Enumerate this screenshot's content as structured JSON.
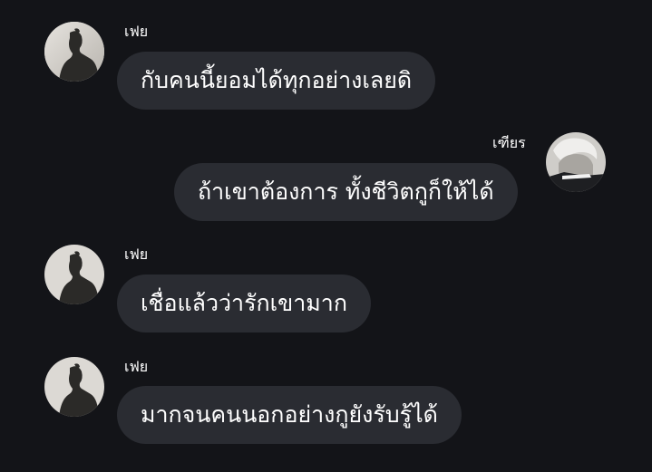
{
  "messages": [
    {
      "sender": "เฟย",
      "side": "left",
      "text": "กับคนนี้ยอมได้ทุกอย่างเลยดิ",
      "avatar": "person-silhouette-icon"
    },
    {
      "sender": "เฑียร",
      "side": "right",
      "text": "ถ้าเขาต้องการ ทั้งชีวิตกูก็ให้ได้",
      "avatar": "person-portrait-icon"
    },
    {
      "sender": "เฟย",
      "side": "left",
      "text": "เชื่อแล้วว่ารักเขามาก",
      "avatar": "person-silhouette-icon"
    },
    {
      "sender": "เฟย",
      "side": "left",
      "text": "มากจนคนนอกอย่างกูยังรับรู้ได้",
      "avatar": "person-silhouette-icon"
    }
  ],
  "colors": {
    "background": "#131418",
    "bubble": "#2a2c32",
    "text": "#ffffff"
  }
}
